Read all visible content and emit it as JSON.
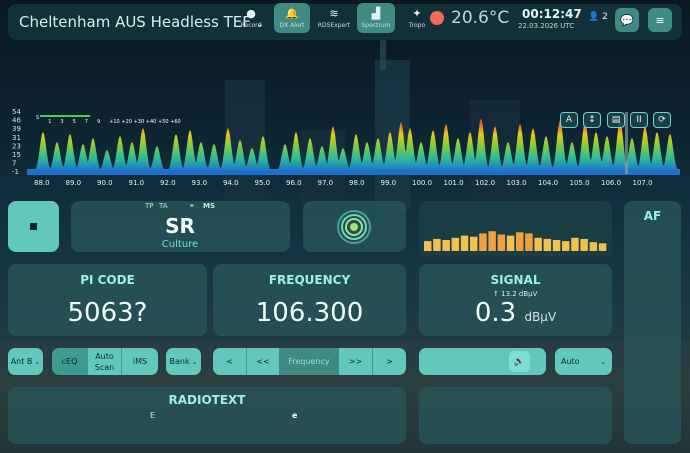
{
  "header": {
    "title": "Cheltenham AUS Headless TEF",
    "nav": [
      {
        "label": "Record",
        "icon": "record-dot-icon",
        "active": false
      },
      {
        "label": "DX Alert",
        "icon": "bell-icon",
        "active": true
      },
      {
        "label": "RDSExpert",
        "icon": "rss-icon",
        "active": false
      },
      {
        "label": "Spectrum",
        "icon": "chart-icon",
        "active": true
      },
      {
        "label": "Tropo",
        "icon": "tropo-dot-icon",
        "active": false
      }
    ],
    "temperature": "20.6°C",
    "time": "00:12:47",
    "date": "22.03.2026 UTC",
    "users": "2",
    "accent": "#62c8bb",
    "tropo_color": "#f06a5c"
  },
  "spectrum": {
    "y_ticks": [
      "54",
      "46",
      "39",
      "31",
      "23",
      "15",
      "7",
      "-1"
    ],
    "scale": [
      "S",
      "1",
      "3",
      "5",
      "7",
      "9",
      "+10",
      "+20",
      "+30",
      "+40",
      "+50",
      "+60"
    ],
    "x_ticks": [
      "88.0",
      "89.0",
      "90.0",
      "91.0",
      "92.0",
      "93.0",
      "94.0",
      "95.0",
      "96.0",
      "97.0",
      "98.0",
      "99.0",
      "100.0",
      "101.0",
      "102.0",
      "103.0",
      "104.0",
      "105.0",
      "106.0",
      "107.0"
    ],
    "controls": [
      "A",
      "↕",
      "▤",
      "II",
      "⟳"
    ]
  },
  "rds": {
    "tp": "TP",
    "ta": "TA",
    "stereo_icon": "stereo-circles-icon",
    "ms": "MS",
    "ps": "SR",
    "pty": "Culture"
  },
  "pi": {
    "label": "PI CODE",
    "value": "5063?"
  },
  "frequency": {
    "label": "FREQUENCY",
    "value": "106.300"
  },
  "signal": {
    "label": "SIGNAL",
    "peak": "13.2 dBµV",
    "value": "0.3",
    "unit": "dBµV"
  },
  "controls": {
    "antenna": "Ant B",
    "ceq": "cEQ",
    "autoscan": "Auto Scan",
    "ims": "iMS",
    "bank": "Bank",
    "prev": "<",
    "prev_fast": "<<",
    "frequency_placeholder": "Frequency",
    "next_fast": ">>",
    "next": ">",
    "volume_level": 0.86,
    "mode": "Auto"
  },
  "af": {
    "label": "AF"
  },
  "radiotext": {
    "label": "RADIOTEXT",
    "line1": "E",
    "line2": "e"
  },
  "signal_bars": [
    0.45,
    0.55,
    0.5,
    0.6,
    0.7,
    0.65,
    0.8,
    0.9,
    0.75,
    0.7,
    0.85,
    0.8,
    0.6,
    0.55,
    0.5,
    0.45,
    0.6,
    0.55,
    0.4,
    0.35
  ]
}
